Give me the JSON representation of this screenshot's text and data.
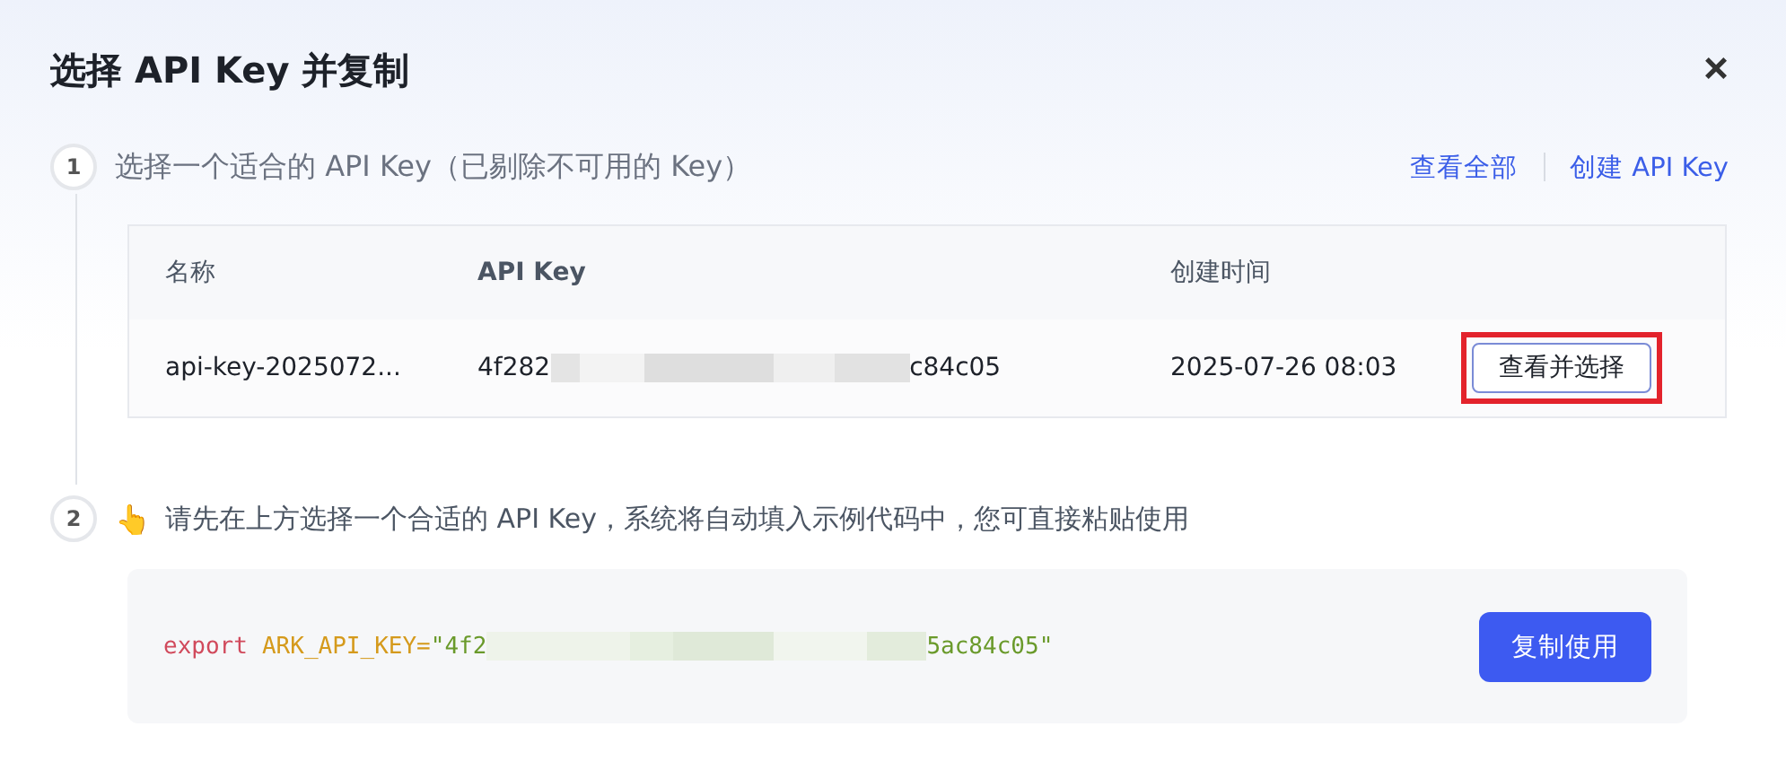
{
  "dialog": {
    "title": "选择 API Key 并复制",
    "close": "×"
  },
  "step_1": {
    "number": "1",
    "text": "选择一个适合的 API Key（已剔除不可用的 Key）",
    "links": [
      "查看全部",
      "创建 API Key"
    ]
  },
  "table": {
    "columns": [
      "名称",
      "API Key",
      "创建时间"
    ],
    "rows": [
      {
        "name": "api-key-2025072...",
        "key": [
          {
            "kind": "text",
            "text": "4f282"
          },
          {
            "kind": "redacted"
          },
          {
            "kind": "text",
            "text": "c84c05"
          }
        ],
        "created": "2025-07-26 08:03",
        "action": {
          "label": "查看并选择",
          "highlighted": true
        }
      }
    ]
  },
  "step_2": {
    "number": "2",
    "icon": "👆",
    "text": "请先在上方选择一个合适的 API Key，系统将自动填入示例代码中，您可直接粘贴使用"
  },
  "code": {
    "keyword": "export",
    "name": "ARK_API_KEY=",
    "value_start": "\"4f2",
    "value_end": "5ac84c05\""
  },
  "copy_button": "复制使用"
}
